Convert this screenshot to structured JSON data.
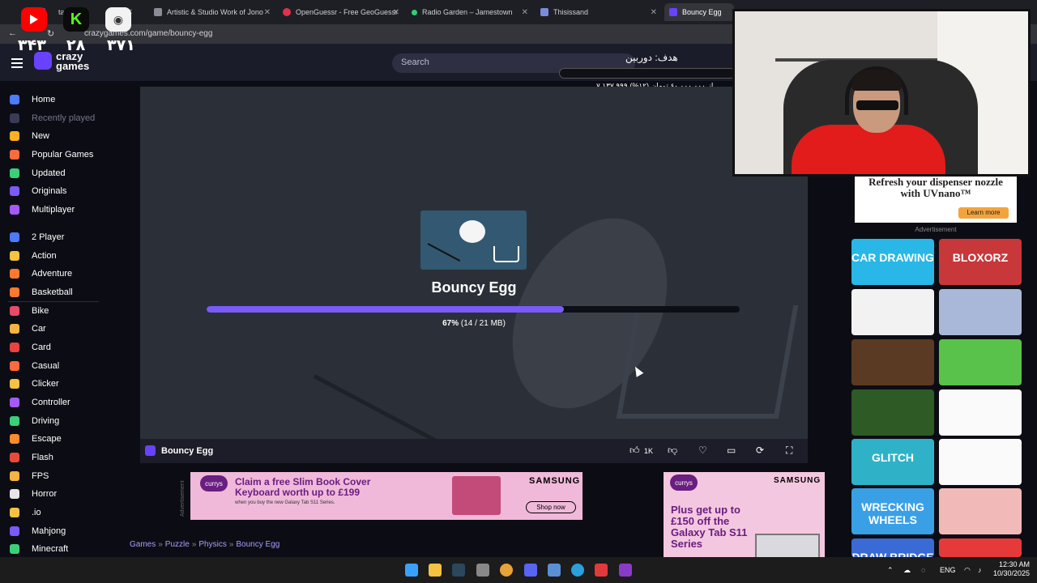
{
  "browser": {
    "tabs": [
      {
        "title": "tatap",
        "color": "#3aa0ff"
      },
      {
        "title": "Artistic & Studio Work of Jono",
        "color": "#8c8c96"
      },
      {
        "title": "OpenGuessr - Free GeoGuessr",
        "color": "#e0324a"
      },
      {
        "title": "Radio Garden – Jamestown",
        "color": "#2dd36f"
      },
      {
        "title": "Thisissand",
        "color": "#7a8bd9"
      },
      {
        "title": "Bouncy Egg",
        "color": "#6842ff"
      }
    ],
    "url": "crazygames.com/game/bouncy-egg"
  },
  "overlay": {
    "stats": [
      "۳۴۳",
      "۲۸",
      "۳۷۱"
    ],
    "goal_title": "هدف: دوربین",
    "goal_progress": "۷,۱۳۷,۹۹۹ از ۶۰,۰۰۰,۰۰۰ تومان (۱۲%)"
  },
  "site": {
    "logo_text": "crazy games",
    "search_placeholder": "Search"
  },
  "sidebar": {
    "items": [
      {
        "label": "Home",
        "color": "#4b7bff",
        "dim": false
      },
      {
        "label": "Recently played",
        "color": "#3a3b55",
        "dim": true
      },
      {
        "label": "New",
        "color": "#ffb020",
        "dim": false
      },
      {
        "label": "Popular Games",
        "color": "#ff6a3d",
        "dim": false
      },
      {
        "label": "Updated",
        "color": "#3ad07a",
        "dim": false
      },
      {
        "label": "Originals",
        "color": "#7a5af8",
        "dim": false
      },
      {
        "label": "Multiplayer",
        "color": "#a55af8",
        "dim": false
      },
      {
        "label": "2 Player",
        "color": "#4b7bff",
        "dim": false
      },
      {
        "label": "Action",
        "color": "#f5c242",
        "dim": false
      },
      {
        "label": "Adventure",
        "color": "#ff7a2e",
        "dim": false
      },
      {
        "label": "Basketball",
        "color": "#ff7a2e",
        "dim": false
      },
      {
        "label": "Bike",
        "color": "#e84a6a",
        "dim": false
      },
      {
        "label": "Car",
        "color": "#f5b342",
        "dim": false
      },
      {
        "label": "Card",
        "color": "#e84242",
        "dim": false
      },
      {
        "label": "Casual",
        "color": "#ff6a3d",
        "dim": false
      },
      {
        "label": "Clicker",
        "color": "#f5c242",
        "dim": false
      },
      {
        "label": "Controller",
        "color": "#a55af8",
        "dim": false
      },
      {
        "label": "Driving",
        "color": "#3ad07a",
        "dim": false
      },
      {
        "label": "Escape",
        "color": "#ff8a2e",
        "dim": false
      },
      {
        "label": "Flash",
        "color": "#e84a3a",
        "dim": false
      },
      {
        "label": "FPS",
        "color": "#f5b342",
        "dim": false
      },
      {
        "label": "Horror",
        "color": "#e6e6e6",
        "dim": false
      },
      {
        "label": ".io",
        "color": "#f5c242",
        "dim": false
      },
      {
        "label": "Mahjong",
        "color": "#7a5af8",
        "dim": false
      },
      {
        "label": "Minecraft",
        "color": "#3ad07a",
        "dim": false
      }
    ]
  },
  "game": {
    "title": "Bouncy Egg",
    "progress_fraction": 0.67,
    "progress_percent": "67%",
    "progress_size": "(14 / 21 MB)",
    "bar_title": "Bouncy Egg",
    "like_count": "1K"
  },
  "ads": {
    "banner_brand": "currys",
    "banner_headline": "Claim a free Slim Book Cover Keyboard worth up to £199",
    "banner_sub": "when you buy the new Galaxy Tab S11 Series.",
    "banner_samsung": "SAMSUNG",
    "banner_shop": "Shop now",
    "vertical_label": "Advertisement",
    "right_brand": "currys",
    "right_samsung": "SAMSUNG",
    "right_text": "Plus get up to £150 off the Galaxy Tab S11 Series",
    "top_text": "Refresh your dispenser nozzle with UVnano™",
    "top_button": "Learn more",
    "top_label": "Advertisement"
  },
  "breadcrumb": [
    "Games",
    "Puzzle",
    "Physics",
    "Bouncy Egg"
  ],
  "tiles": [
    {
      "label": "CAR DRAWING",
      "bg": "#28b7e6",
      "fg": "#ffffff"
    },
    {
      "label": "BLOXORZ",
      "bg": "#c8373a",
      "fg": "#ffffff"
    },
    {
      "label": "",
      "bg": "#f2f2f2",
      "fg": "#111111"
    },
    {
      "label": "",
      "bg": "#a9b8d8",
      "fg": "#ffffff"
    },
    {
      "label": "",
      "bg": "#5a3a22",
      "fg": "#ffffff"
    },
    {
      "label": "",
      "bg": "#59c24a",
      "fg": "#ffffff"
    },
    {
      "label": "",
      "bg": "#2e5a26",
      "fg": "#ffffff"
    },
    {
      "label": "",
      "bg": "#fafafa",
      "fg": "#111111"
    },
    {
      "label": "GLITCH",
      "bg": "#2fb2c7",
      "fg": "#ffffff"
    },
    {
      "label": "",
      "bg": "#fafafa",
      "fg": "#111111"
    },
    {
      "label": "WRECKING WHEELS",
      "bg": "#3aa0e6",
      "fg": "#ffffff"
    },
    {
      "label": "",
      "bg": "#f2b9b9",
      "fg": "#111111"
    },
    {
      "label": "DRAW BRIDGE",
      "bg": "#3a6ad6",
      "fg": "#ffffff"
    },
    {
      "label": "",
      "bg": "#e63a3a",
      "fg": "#ffffff"
    }
  ],
  "taskbar": {
    "lang": "ENG",
    "time": "12:30 AM",
    "date": "10/30/2025"
  }
}
